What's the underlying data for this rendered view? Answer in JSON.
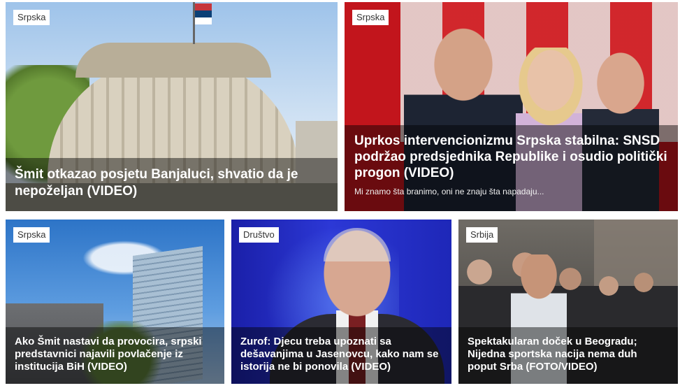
{
  "cards": [
    {
      "category": "Srpska",
      "title": "Šmit otkazao posjetu Banjaluci, shvatio da je nepoželjan (VIDEO)",
      "subtitle": ""
    },
    {
      "category": "Srpska",
      "title": "Uprkos intervencionizmu Srpska stabilna: SNSD podržao predsjednika Republike i osudio politički progon (VIDEO)",
      "subtitle": "Mi znamo šta branimo, oni ne znaju šta napadaju..."
    },
    {
      "category": "Srpska",
      "title": "Ako Šmit nastavi da provocira, srpski predstavnici najavili povlačenje iz institucija BiH (VIDEO)",
      "subtitle": ""
    },
    {
      "category": "Društvo",
      "title": "Zurof: Djecu treba upoznati sa dešavanjima u Jasenovcu, kako nam se istorija ne bi ponovila (VIDEO)",
      "subtitle": ""
    },
    {
      "category": "Srbija",
      "title": "Spektakularan doček u Beogradu; Nijedna sportska nacija nema duh poput Srba (FOTO/VIDEO)",
      "subtitle": ""
    }
  ]
}
